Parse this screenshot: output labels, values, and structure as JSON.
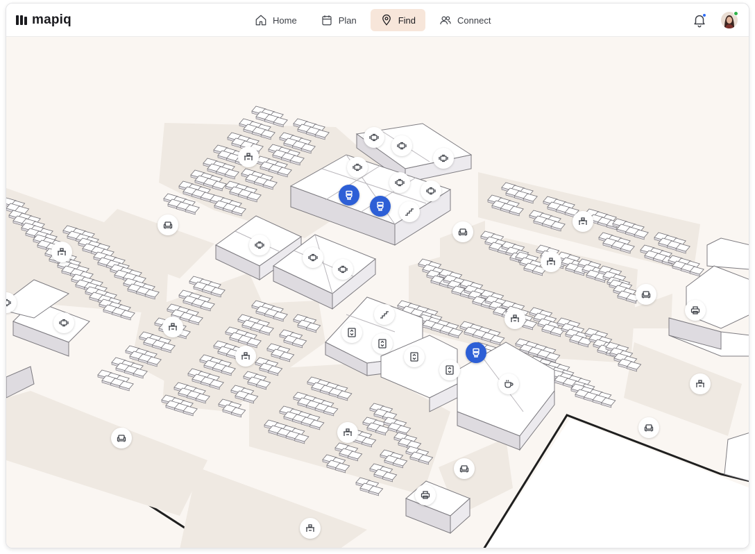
{
  "app": {
    "name": "mapiq"
  },
  "nav": {
    "items": [
      {
        "label": "Home",
        "icon": "home-icon",
        "active": false
      },
      {
        "label": "Plan",
        "icon": "calendar-icon",
        "active": false
      },
      {
        "label": "Find",
        "icon": "location-pin-icon",
        "active": true
      },
      {
        "label": "Connect",
        "icon": "people-icon",
        "active": false
      }
    ]
  },
  "header": {
    "notifications_indicator": "unread",
    "user_status": "online"
  },
  "colors": {
    "accent_active_nav": "#f7e6da",
    "pin_selected": "#2d5fd6",
    "floor": "#faf6f2",
    "zone": "#efe9e2",
    "status_online": "#2fb24a",
    "notification": "#2f6df6"
  },
  "map": {
    "selected_space_type": "restroom",
    "pins": [
      {
        "type": "meeting-room",
        "selected": false
      },
      {
        "type": "meeting-room",
        "selected": false
      },
      {
        "type": "meeting-room",
        "selected": false
      },
      {
        "type": "meeting-room",
        "selected": false
      },
      {
        "type": "meeting-room",
        "selected": false
      },
      {
        "type": "meeting-room",
        "selected": false
      },
      {
        "type": "meeting-room",
        "selected": false
      },
      {
        "type": "meeting-room",
        "selected": false
      },
      {
        "type": "meeting-room",
        "selected": false
      },
      {
        "type": "meeting-room",
        "selected": false
      },
      {
        "type": "meeting-room",
        "selected": false
      },
      {
        "type": "restroom",
        "selected": true
      },
      {
        "type": "restroom",
        "selected": true
      },
      {
        "type": "restroom",
        "selected": true
      },
      {
        "type": "stairs",
        "selected": false
      },
      {
        "type": "stairs",
        "selected": false
      },
      {
        "type": "elevator",
        "selected": false
      },
      {
        "type": "elevator",
        "selected": false
      },
      {
        "type": "elevator",
        "selected": false
      },
      {
        "type": "elevator",
        "selected": false
      },
      {
        "type": "coffee",
        "selected": false
      },
      {
        "type": "desk-area",
        "selected": false
      },
      {
        "type": "desk-area",
        "selected": false
      },
      {
        "type": "desk-area",
        "selected": false
      },
      {
        "type": "desk-area",
        "selected": false
      },
      {
        "type": "desk-area",
        "selected": false
      },
      {
        "type": "desk-area",
        "selected": false
      },
      {
        "type": "desk-area",
        "selected": false
      },
      {
        "type": "desk-area",
        "selected": false
      },
      {
        "type": "desk-area",
        "selected": false
      },
      {
        "type": "desk-area",
        "selected": false
      },
      {
        "type": "lounge",
        "selected": false
      },
      {
        "type": "lounge",
        "selected": false
      },
      {
        "type": "lounge",
        "selected": false
      },
      {
        "type": "lounge",
        "selected": false
      },
      {
        "type": "lounge",
        "selected": false
      },
      {
        "type": "lounge",
        "selected": false
      },
      {
        "type": "printer",
        "selected": false
      },
      {
        "type": "printer",
        "selected": false
      }
    ]
  }
}
